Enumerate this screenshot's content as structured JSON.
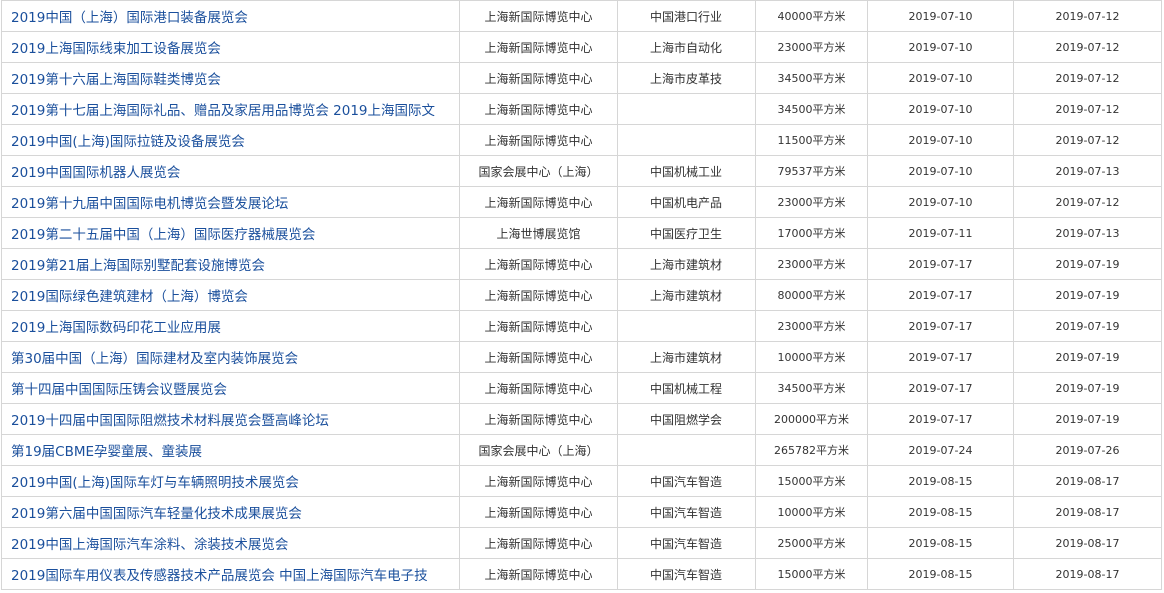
{
  "rows": [
    {
      "name": "2019中国（上海）国际港口装备展览会",
      "venue": "上海新国际博览中心",
      "organizer": "中国港口行业",
      "area": "40000平方米",
      "start": "2019-07-10",
      "end": "2019-07-12"
    },
    {
      "name": "2019上海国际线束加工设备展览会",
      "venue": "上海新国际博览中心",
      "organizer": "上海市自动化",
      "area": "23000平方米",
      "start": "2019-07-10",
      "end": "2019-07-12"
    },
    {
      "name": "2019第十六届上海国际鞋类博览会",
      "venue": "上海新国际博览中心",
      "organizer": "上海市皮革技",
      "area": "34500平方米",
      "start": "2019-07-10",
      "end": "2019-07-12"
    },
    {
      "name": "2019第十七届上海国际礼品、赠品及家居用品博览会 2019上海国际文",
      "venue": "上海新国际博览中心",
      "organizer": "",
      "area": "34500平方米",
      "start": "2019-07-10",
      "end": "2019-07-12"
    },
    {
      "name": "2019中国(上海)国际拉链及设备展览会",
      "venue": "上海新国际博览中心",
      "organizer": "",
      "area": "11500平方米",
      "start": "2019-07-10",
      "end": "2019-07-12"
    },
    {
      "name": "2019中国国际机器人展览会",
      "venue": "国家会展中心（上海）",
      "organizer": "中国机械工业",
      "area": "79537平方米",
      "start": "2019-07-10",
      "end": "2019-07-13"
    },
    {
      "name": "2019第十九届中国国际电机博览会暨发展论坛",
      "venue": "上海新国际博览中心",
      "organizer": "中国机电产品",
      "area": "23000平方米",
      "start": "2019-07-10",
      "end": "2019-07-12"
    },
    {
      "name": "2019第二十五届中国（上海）国际医疗器械展览会",
      "venue": "上海世博展览馆",
      "organizer": "中国医疗卫生",
      "area": "17000平方米",
      "start": "2019-07-11",
      "end": "2019-07-13"
    },
    {
      "name": "2019第21届上海国际别墅配套设施博览会",
      "venue": "上海新国际博览中心",
      "organizer": "上海市建筑材",
      "area": "23000平方米",
      "start": "2019-07-17",
      "end": "2019-07-19"
    },
    {
      "name": "2019国际绿色建筑建材（上海）博览会",
      "venue": "上海新国际博览中心",
      "organizer": "上海市建筑材",
      "area": "80000平方米",
      "start": "2019-07-17",
      "end": "2019-07-19"
    },
    {
      "name": "2019上海国际数码印花工业应用展",
      "venue": "上海新国际博览中心",
      "organizer": "",
      "area": "23000平方米",
      "start": "2019-07-17",
      "end": "2019-07-19"
    },
    {
      "name": "第30届中国（上海）国际建材及室内装饰展览会",
      "venue": "上海新国际博览中心",
      "organizer": "上海市建筑材",
      "area": "10000平方米",
      "start": "2019-07-17",
      "end": "2019-07-19"
    },
    {
      "name": "第十四届中国国际压铸会议暨展览会",
      "venue": "上海新国际博览中心",
      "organizer": "中国机械工程",
      "area": "34500平方米",
      "start": "2019-07-17",
      "end": "2019-07-19"
    },
    {
      "name": "2019十四届中国国际阻燃技术材料展览会暨高峰论坛",
      "venue": "上海新国际博览中心",
      "organizer": "中国阻燃学会",
      "area": "200000平方米",
      "start": "2019-07-17",
      "end": "2019-07-19"
    },
    {
      "name": "第19届CBME孕婴童展、童装展",
      "venue": "国家会展中心（上海）",
      "organizer": "",
      "area": "265782平方米",
      "start": "2019-07-24",
      "end": "2019-07-26"
    },
    {
      "name": "2019中国(上海)国际车灯与车辆照明技术展览会",
      "venue": "上海新国际博览中心",
      "organizer": "中国汽车智造",
      "area": "15000平方米",
      "start": "2019-08-15",
      "end": "2019-08-17"
    },
    {
      "name": "2019第六届中国国际汽车轻量化技术成果展览会",
      "venue": "上海新国际博览中心",
      "organizer": "中国汽车智造",
      "area": "10000平方米",
      "start": "2019-08-15",
      "end": "2019-08-17"
    },
    {
      "name": "2019中国上海国际汽车涂料、涂装技术展览会",
      "venue": "上海新国际博览中心",
      "organizer": "中国汽车智造",
      "area": "25000平方米",
      "start": "2019-08-15",
      "end": "2019-08-17"
    },
    {
      "name": "2019国际车用仪表及传感器技术产品展览会 中国上海国际汽车电子技",
      "venue": "上海新国际博览中心",
      "organizer": "中国汽车智造",
      "area": "15000平方米",
      "start": "2019-08-15",
      "end": "2019-08-17"
    }
  ]
}
